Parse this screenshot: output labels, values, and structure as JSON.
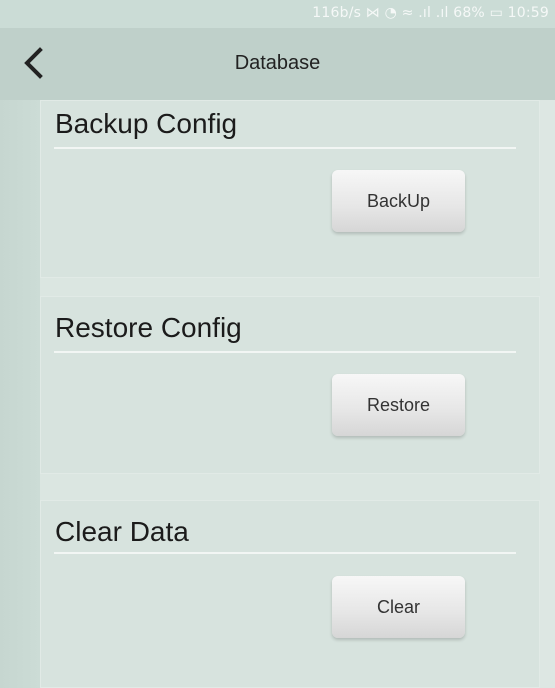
{
  "status_bar": {
    "text": "116b/s ⋈ ◔ ≈ .ıl .ıl 68% ▭ 10:59"
  },
  "header": {
    "title": "Database"
  },
  "sections": [
    {
      "title": "Backup Config",
      "button": "BackUp"
    },
    {
      "title": "Restore Config",
      "button": "Restore"
    },
    {
      "title": "Clear Data",
      "button": "Clear"
    }
  ]
}
